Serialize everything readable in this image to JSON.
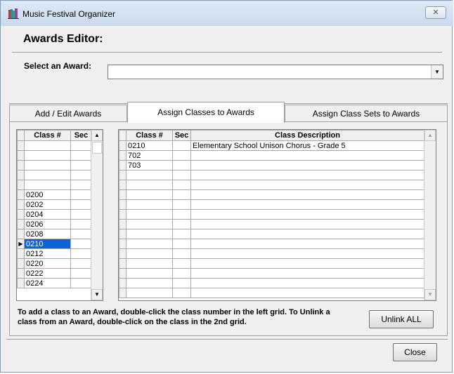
{
  "window": {
    "title": "Music Festival Organizer",
    "close_glyph": "✕"
  },
  "heading": "Awards Editor:",
  "award_select": {
    "label": "Select an Award:",
    "value": ""
  },
  "tabs": [
    {
      "label": "Add / Edit Awards",
      "active": false
    },
    {
      "label": "Assign Classes to Awards",
      "active": true
    },
    {
      "label": "Assign Class Sets to Awards",
      "active": false
    }
  ],
  "left_grid": {
    "headers": [
      "Class #",
      "Sec"
    ],
    "rows": [
      {
        "class": "",
        "sec": ""
      },
      {
        "class": "",
        "sec": ""
      },
      {
        "class": "",
        "sec": ""
      },
      {
        "class": "",
        "sec": ""
      },
      {
        "class": "",
        "sec": ""
      },
      {
        "class": "0200",
        "sec": ""
      },
      {
        "class": "0202",
        "sec": ""
      },
      {
        "class": "0204",
        "sec": ""
      },
      {
        "class": "0206",
        "sec": ""
      },
      {
        "class": "0208",
        "sec": ""
      },
      {
        "class": "0210",
        "sec": "",
        "selected": true
      },
      {
        "class": "0212",
        "sec": ""
      },
      {
        "class": "0220",
        "sec": ""
      },
      {
        "class": "0222",
        "sec": ""
      },
      {
        "class": "0224",
        "sec": ""
      }
    ]
  },
  "right_grid": {
    "headers": [
      "Class #",
      "Sec",
      "Class Description"
    ],
    "rows": [
      {
        "class": "0210",
        "sec": "",
        "desc": "Elementary School Unison Chorus - Grade 5"
      },
      {
        "class": "702",
        "sec": "",
        "desc": ""
      },
      {
        "class": "703",
        "sec": "",
        "desc": ""
      },
      {
        "class": "",
        "sec": "",
        "desc": ""
      },
      {
        "class": "",
        "sec": "",
        "desc": ""
      },
      {
        "class": "",
        "sec": "",
        "desc": ""
      },
      {
        "class": "",
        "sec": "",
        "desc": ""
      },
      {
        "class": "",
        "sec": "",
        "desc": ""
      },
      {
        "class": "",
        "sec": "",
        "desc": ""
      },
      {
        "class": "",
        "sec": "",
        "desc": ""
      },
      {
        "class": "",
        "sec": "",
        "desc": ""
      },
      {
        "class": "",
        "sec": "",
        "desc": ""
      },
      {
        "class": "",
        "sec": "",
        "desc": ""
      },
      {
        "class": "",
        "sec": "",
        "desc": ""
      },
      {
        "class": "",
        "sec": "",
        "desc": ""
      },
      {
        "class": "",
        "sec": "",
        "desc": ""
      }
    ]
  },
  "help_text": "To add a class to an Award, double-click the class number in the left grid.  To Unlink a class from an Award, double-click on the class in the 2nd grid.",
  "buttons": {
    "unlink_all": "Unlink ALL",
    "close": "Close"
  },
  "icons": {
    "app": "music-books-icon",
    "dropdown": "chevron-down-icon",
    "row_pointer": "row-pointer-icon"
  },
  "colors": {
    "selection": "#0a64d8"
  }
}
